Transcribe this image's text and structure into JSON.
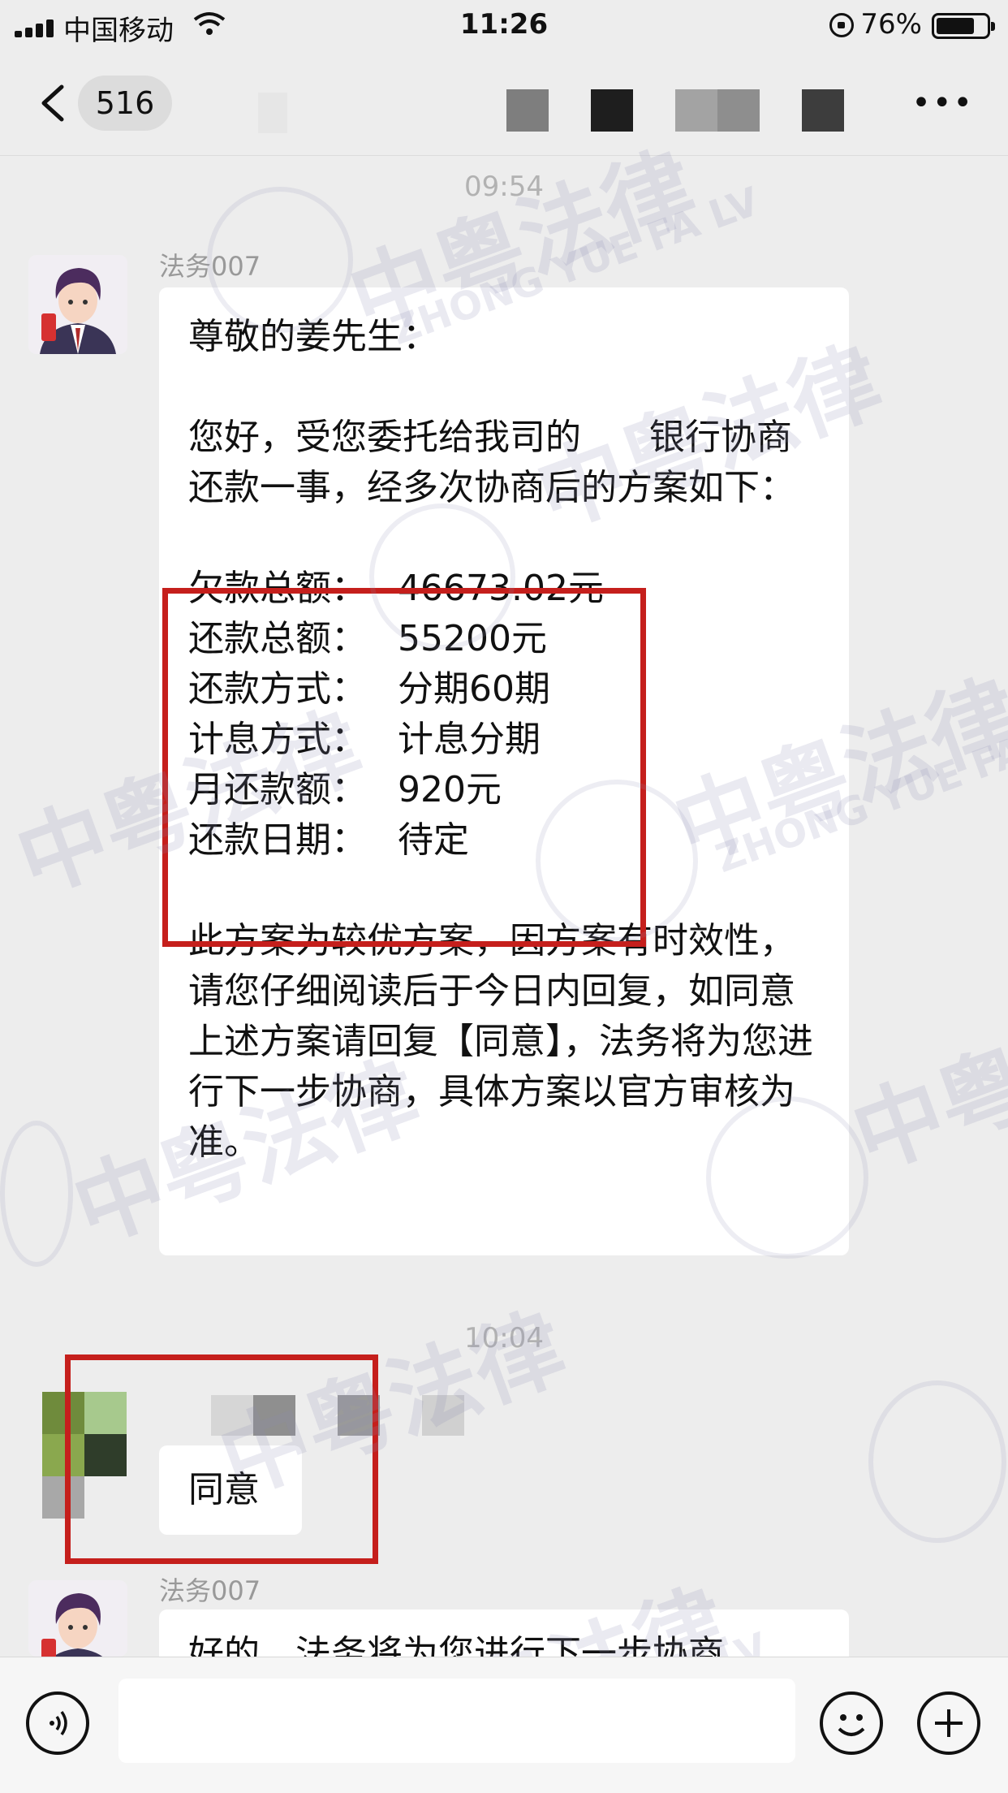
{
  "status_bar": {
    "carrier": "中国移动",
    "time": "11:26",
    "battery": "76%"
  },
  "nav": {
    "unread_count": "516"
  },
  "messages": {
    "time_1": "09:54",
    "msg1_sender": "法务007",
    "msg1_greeting": "尊敬的姜先生：",
    "msg1_intro": "您好，受您委托给我司的      银行协商还款一事，经多次协商后的方案如下：",
    "plan": [
      {
        "label": "欠款总额：",
        "value": "46673.02元"
      },
      {
        "label": "还款总额：",
        "value": "55200元"
      },
      {
        "label": "还款方式：",
        "value": "分期60期"
      },
      {
        "label": "计息方式：",
        "value": "计息分期"
      },
      {
        "label": "月还款额：",
        "value": "920元"
      },
      {
        "label": "还款日期：",
        "value": "待定"
      }
    ],
    "msg1_outro": "此方案为较优方案，因方案有时效性，请您仔细阅读后于今日内回复，如同意上述方案请回复【同意】，法务将为您进行下一步协商，具体方案以官方审核为准。",
    "time_2": "10:04",
    "reply": "同意",
    "msg3_sender": "法务007",
    "msg3_text": "好的，法务将为您进行下一步协商"
  },
  "watermark": {
    "cn": "中粤法律",
    "en": "ZHONG YUE FA LV"
  },
  "colors": {
    "annotation_red": "#c51f1c",
    "chat_bg": "#ededed"
  }
}
